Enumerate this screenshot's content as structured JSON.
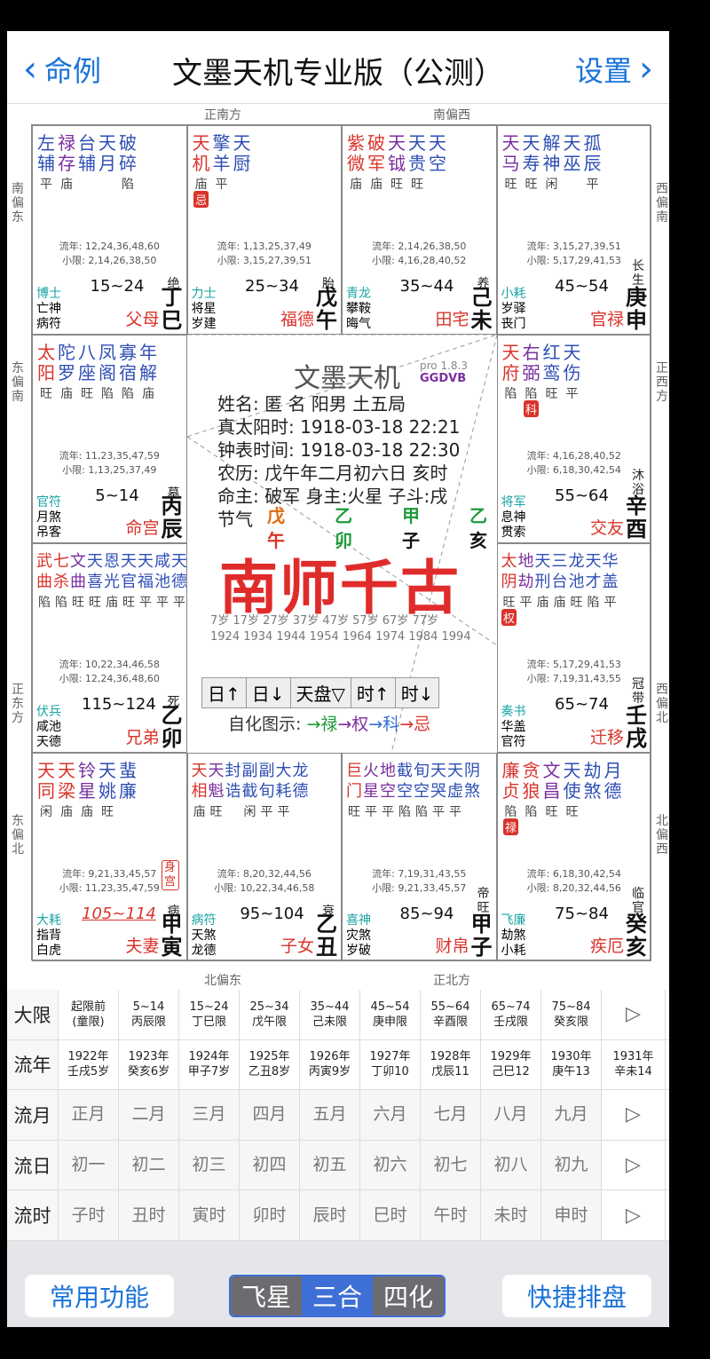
{
  "nav": {
    "back": "命例",
    "title": "文墨天机专业版（公测）",
    "settings": "设置"
  },
  "directions": {
    "top_left": "正南方",
    "top_right": "南偏西",
    "bottom_left": "北偏东",
    "bottom_right": "正北方",
    "left1": "南偏东",
    "left2": "东偏南",
    "left3": "正东方",
    "left4": "东偏北",
    "right1": "西偏南",
    "right2": "正西方",
    "right3": "西偏北",
    "right4": "北偏西"
  },
  "palaces": [
    {
      "id": "si",
      "stars": [
        [
          "左",
          "辅",
          "平",
          "",
          "blue"
        ],
        [
          "禄",
          "存",
          "庙",
          "",
          "purple"
        ],
        [
          "台",
          "辅",
          "",
          "",
          "blue"
        ],
        [
          "天",
          "月",
          "",
          "",
          "blue"
        ],
        [
          "破",
          "碎",
          "陷",
          "",
          "blue"
        ]
      ],
      "ly": "流年: 12,24,36,48,60",
      "xx": "小限: 2,14,26,38,50",
      "gs": "博士",
      "s1": "亡神",
      "s2": "病符",
      "range": "15~24",
      "cs": "绝",
      "pname": "父母",
      "gz": "丁巳"
    },
    {
      "id": "wu",
      "stars": [
        [
          "天",
          "机",
          "庙",
          "忌",
          "red"
        ],
        [
          "擎",
          "羊",
          "平",
          "",
          "blue"
        ],
        [
          "天",
          "厨",
          "",
          "",
          "blue"
        ]
      ],
      "ly": "流年: 1,13,25,37,49",
      "xx": "小限: 3,15,27,39,51",
      "gs": "力士",
      "s1": "将星",
      "s2": "岁建",
      "range": "25~34",
      "cs": "胎",
      "pname": "福德",
      "gz": "戊午"
    },
    {
      "id": "wei",
      "stars": [
        [
          "紫",
          "微",
          "庙",
          "",
          "red"
        ],
        [
          "破",
          "军",
          "庙",
          "",
          "red"
        ],
        [
          "天",
          "钺",
          "旺",
          "",
          "purple"
        ],
        [
          "天",
          "贵",
          "旺",
          "",
          "blue"
        ],
        [
          "天",
          "空",
          "",
          "",
          "blue"
        ]
      ],
      "ly": "流年: 2,14,26,38,50",
      "xx": "小限: 4,16,28,40,52",
      "gs": "青龙",
      "s1": "攀鞍",
      "s2": "晦气",
      "range": "35~44",
      "cs": "养",
      "pname": "田宅",
      "gz": "己未"
    },
    {
      "id": "shen",
      "stars": [
        [
          "天",
          "马",
          "旺",
          "",
          "purple"
        ],
        [
          "天",
          "寿",
          "旺",
          "",
          "blue"
        ],
        [
          "解",
          "神",
          "闲",
          "",
          "blue"
        ],
        [
          "天",
          "巫",
          "",
          "",
          "blue"
        ],
        [
          "孤",
          "辰",
          "平",
          "",
          "blue"
        ]
      ],
      "ly": "流年: 3,15,27,39,51",
      "xx": "小限: 5,17,29,41,53",
      "gs": "小耗",
      "s1": "岁驿",
      "s2": "丧门",
      "range": "45~54",
      "cs": "长生",
      "pname": "官禄",
      "gz": "庚申"
    },
    {
      "id": "chen",
      "stars": [
        [
          "太",
          "阳",
          "旺",
          "",
          "red"
        ],
        [
          "陀",
          "罗",
          "庙",
          "",
          "blue"
        ],
        [
          "八",
          "座",
          "旺",
          "",
          "blue"
        ],
        [
          "凤",
          "阁",
          "陷",
          "",
          "blue"
        ],
        [
          "寡",
          "宿",
          "陷",
          "",
          "blue"
        ],
        [
          "年",
          "解",
          "庙",
          "",
          "blue"
        ]
      ],
      "ly": "流年: 11,23,35,47,59",
      "xx": "小限: 1,13,25,37,49",
      "gs": "官符",
      "s1": "月煞",
      "s2": "吊客",
      "range": "5~14",
      "cs": "墓",
      "pname": "命宫",
      "gz": "丙辰"
    },
    {
      "id": "you",
      "stars": [
        [
          "天",
          "府",
          "陷",
          "",
          "red"
        ],
        [
          "右",
          "弼",
          "陷",
          "科",
          "purple"
        ],
        [
          "红",
          "鸾",
          "旺",
          "",
          "blue"
        ],
        [
          "天",
          "伤",
          "平",
          "",
          "blue"
        ]
      ],
      "ly": "流年: 4,16,28,40,52",
      "xx": "小限: 6,18,30,42,54",
      "gs": "将军",
      "s1": "息神",
      "s2": "贯索",
      "range": "55~64",
      "cs": "沐浴",
      "pname": "交友",
      "gz": "辛酉"
    },
    {
      "id": "mao",
      "stars": [
        [
          "武",
          "曲",
          "陷",
          "",
          "red"
        ],
        [
          "七",
          "杀",
          "陷",
          "",
          "red"
        ],
        [
          "文",
          "曲",
          "旺",
          "",
          "purple"
        ],
        [
          "天",
          "喜",
          "旺",
          "",
          "blue"
        ],
        [
          "恩",
          "光",
          "庙",
          "",
          "blue"
        ],
        [
          "天",
          "官",
          "旺",
          "",
          "blue"
        ],
        [
          "天",
          "福",
          "平",
          "",
          "blue"
        ],
        [
          "咸",
          "池",
          "平",
          "",
          "blue"
        ],
        [
          "天",
          "德",
          "平",
          "",
          "blue"
        ]
      ],
      "ly": "流年: 10,22,34,46,58",
      "xx": "小限: 12,24,36,48,60",
      "gs": "伏兵",
      "s1": "咸池",
      "s2": "天德",
      "range": "115~124",
      "cs": "死",
      "pname": "兄弟",
      "gz": "乙卯"
    },
    {
      "id": "xu",
      "stars": [
        [
          "太",
          "阴",
          "旺",
          "权",
          "red"
        ],
        [
          "地",
          "劫",
          "平",
          "",
          "purple"
        ],
        [
          "天",
          "刑",
          "庙",
          "",
          "blue"
        ],
        [
          "三",
          "台",
          "庙",
          "",
          "blue"
        ],
        [
          "龙",
          "池",
          "旺",
          "",
          "blue"
        ],
        [
          "天",
          "才",
          "陷",
          "",
          "blue"
        ],
        [
          "华",
          "盖",
          "平",
          "",
          "blue"
        ]
      ],
      "ly": "流年: 5,17,29,41,53",
      "xx": "小限: 7,19,31,43,55",
      "gs": "奏书",
      "s1": "华盖",
      "s2": "官符",
      "range": "65~74",
      "cs": "冠带",
      "pname": "迁移",
      "gz": "壬戌"
    },
    {
      "id": "yin",
      "stars": [
        [
          "天",
          "同",
          "闲",
          "",
          "red"
        ],
        [
          "天",
          "梁",
          "庙",
          "",
          "red"
        ],
        [
          "铃",
          "星",
          "庙",
          "",
          "purple"
        ],
        [
          "天",
          "姚",
          "旺",
          "",
          "blue"
        ],
        [
          "蜚",
          "廉",
          "",
          "",
          "blue"
        ]
      ],
      "ly": "流年: 9,21,33,45,57",
      "xx": "小限: 11,23,35,47,59",
      "gs": "大耗",
      "s1": "指背",
      "s2": "白虎",
      "range": "105~114",
      "cs": "病",
      "pname": "夫妻",
      "gz": "甲寅",
      "shen": "身宫"
    },
    {
      "id": "chou",
      "stars": [
        [
          "天",
          "相",
          "庙",
          "",
          "red"
        ],
        [
          "天",
          "魁",
          "旺",
          "",
          "purple"
        ],
        [
          "封",
          "诰",
          "",
          "",
          "blue"
        ],
        [
          "副",
          "截",
          "闲",
          "",
          "blue"
        ],
        [
          "副",
          "旬",
          "平",
          "",
          "blue"
        ],
        [
          "大",
          "耗",
          "平",
          "",
          "blue"
        ],
        [
          "龙",
          "德",
          "",
          "",
          "blue"
        ]
      ],
      "ly": "流年: 8,20,32,44,56",
      "xx": "小限: 10,22,34,46,58",
      "gs": "病符",
      "s1": "天煞",
      "s2": "龙德",
      "range": "95~104",
      "cs": "衰",
      "pname": "子女",
      "gz": "乙丑"
    },
    {
      "id": "zi",
      "stars": [
        [
          "巨",
          "门",
          "旺",
          "",
          "red"
        ],
        [
          "火",
          "星",
          "平",
          "",
          "purple"
        ],
        [
          "地",
          "空",
          "平",
          "",
          "purple"
        ],
        [
          "截",
          "空",
          "陷",
          "",
          "blue"
        ],
        [
          "旬",
          "空",
          "陷",
          "",
          "blue"
        ],
        [
          "天",
          "哭",
          "平",
          "",
          "blue"
        ],
        [
          "天",
          "虚",
          "平",
          "",
          "blue"
        ],
        [
          "阴",
          "煞",
          "",
          "",
          "blue"
        ]
      ],
      "ly": "流年: 7,19,31,43,55",
      "xx": "小限: 9,21,33,45,57",
      "gs": "喜神",
      "s1": "灾煞",
      "s2": "岁破",
      "range": "85~94",
      "cs": "帝旺",
      "pname": "财帛",
      "gz": "甲子"
    },
    {
      "id": "hai",
      "stars": [
        [
          "廉",
          "贞",
          "陷",
          "禄",
          "red"
        ],
        [
          "贪",
          "狼",
          "陷",
          "",
          "red"
        ],
        [
          "文",
          "昌",
          "旺",
          "",
          "purple"
        ],
        [
          "天",
          "使",
          "旺",
          "",
          "blue"
        ],
        [
          "劫",
          "煞",
          "",
          "",
          "blue"
        ],
        [
          "月",
          "德",
          "",
          "",
          "blue"
        ]
      ],
      "ly": "流年: 6,18,30,42,54",
      "xx": "小限: 8,20,32,44,56",
      "gs": "飞廉",
      "s1": "劫煞",
      "s2": "小耗",
      "range": "75~84",
      "cs": "临官",
      "pname": "疾厄",
      "gz": "癸亥"
    }
  ],
  "center": {
    "logo": "文墨天机",
    "ver": "pro 1.8.3",
    "code": "GGDVB",
    "name": "姓名: 匿 名          阳男 土五局",
    "sun_time": "真太阳时: 1918-03-18 22:21",
    "clock_time": "钟表时间: 1918-03-18 22:30",
    "lunar": "农历: 戊午年二月初六日 亥时",
    "ming": "命主: 破军 身主:火星 子斗:戌",
    "jieqi": "节气",
    "pillars": [
      [
        "戊",
        "午",
        "#e06a12"
      ],
      [
        "乙",
        "卯",
        "#1e9a3a"
      ],
      [
        "甲",
        "子",
        "#1e9a3a"
      ],
      [
        "乙",
        "亥",
        "#1e9a3a"
      ]
    ],
    "watermark": "南师千古",
    "ages": "7岁  17岁  27岁  37岁  47岁  57岁  67岁  77岁",
    "years": "1924 1934 1944 1954 1964 1974 1984   1994",
    "ctrls": [
      "日↑",
      "日↓",
      "天盘▽",
      "时↑",
      "时↓"
    ],
    "legend": "自化图示:"
  },
  "table": {
    "rows": [
      {
        "head": "大限",
        "cells": [
          "起限前\n(童限)",
          "5~14\n丙辰限",
          "15~24\n丁巳限",
          "25~34\n戊午限",
          "35~44\n己未限",
          "45~54\n庚申限",
          "55~64\n辛酉限",
          "65~74\n壬戌限",
          "75~84\n癸亥限"
        ],
        "arrow": "▷"
      },
      {
        "head": "流年",
        "cells": [
          "1922年\n壬戌5岁",
          "1923年\n癸亥6岁",
          "1924年\n甲子7岁",
          "1925年\n乙丑8岁",
          "1926年\n丙寅9岁",
          "1927年\n丁卯10",
          "1928年\n戊辰11",
          "1929年\n己巳12",
          "1930年\n庚午13"
        ],
        "arrow": "1931年\n辛未14"
      },
      {
        "head": "流月",
        "cells": [
          "正月",
          "二月",
          "三月",
          "四月",
          "五月",
          "六月",
          "七月",
          "八月",
          "九月"
        ],
        "arrow": "▷"
      },
      {
        "head": "流日",
        "cells": [
          "初一",
          "初二",
          "初三",
          "初四",
          "初五",
          "初六",
          "初七",
          "初八",
          "初九"
        ],
        "arrow": "▷"
      },
      {
        "head": "流时",
        "cells": [
          "子时",
          "丑时",
          "寅时",
          "卯时",
          "辰时",
          "巳时",
          "午时",
          "未时",
          "申时"
        ],
        "arrow": "▷"
      }
    ]
  },
  "bottom": {
    "left": "常用功能",
    "seg": [
      "飞星",
      "三合",
      "四化"
    ],
    "right": "快捷排盘"
  }
}
